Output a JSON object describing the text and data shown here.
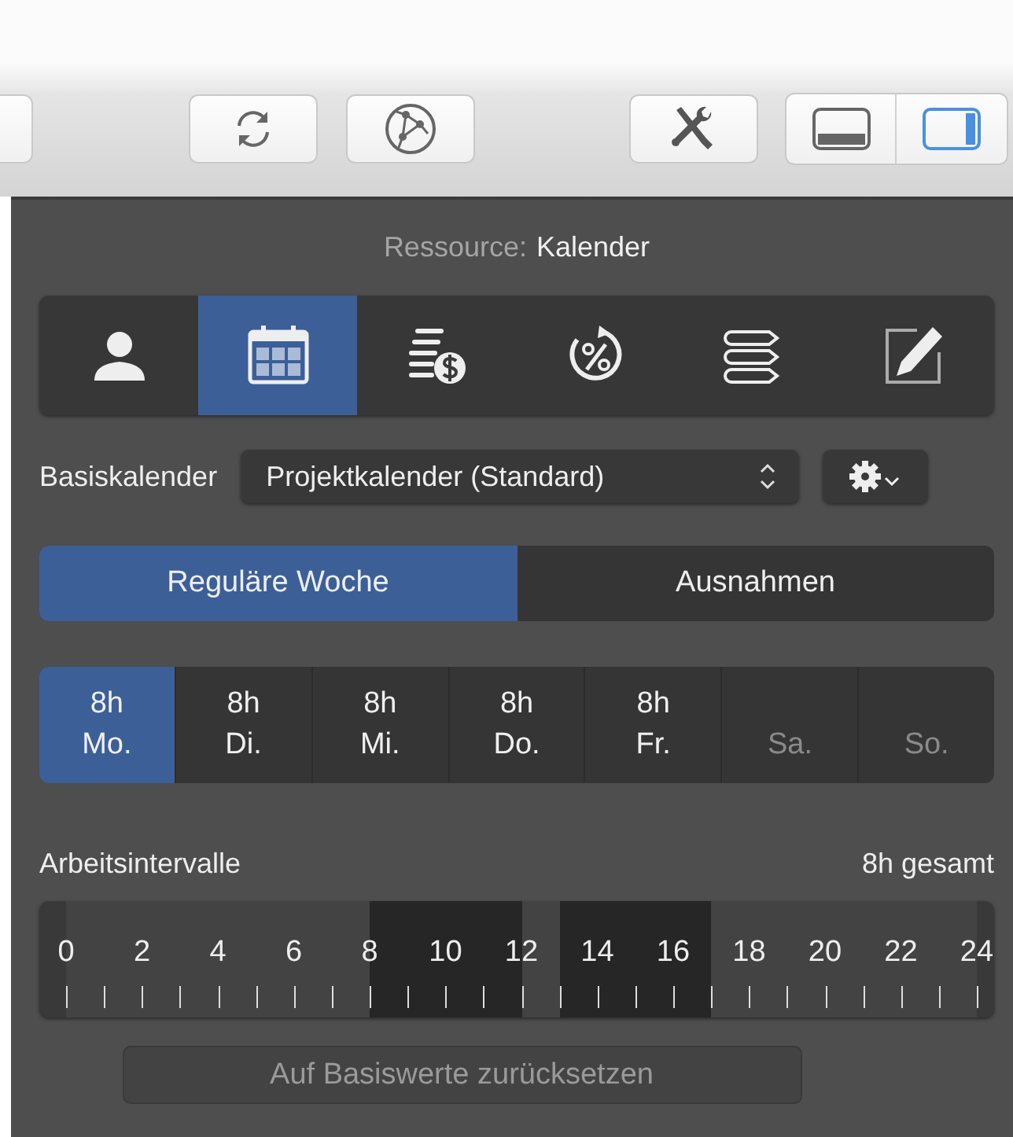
{
  "toolbar": {
    "buttons": [
      {
        "kind": "partial"
      },
      {
        "kind": "refresh"
      },
      {
        "kind": "network"
      },
      {
        "kind": "tools"
      }
    ],
    "layout_toggle": [
      {
        "kind": "bottom",
        "selected": false
      },
      {
        "kind": "right",
        "selected": true
      }
    ]
  },
  "inspector": {
    "title_label": "Ressource:",
    "title_value": "Kalender",
    "tabs": [
      {
        "kind": "person",
        "selected": false
      },
      {
        "kind": "calendar",
        "selected": true
      },
      {
        "kind": "cost",
        "selected": false
      },
      {
        "kind": "percent",
        "selected": false
      },
      {
        "kind": "list",
        "selected": false
      },
      {
        "kind": "edit",
        "selected": false
      }
    ],
    "base_calendar": {
      "label": "Basiskalender",
      "value": "Projektkalender (Standard)"
    },
    "mode": [
      {
        "label": "Reguläre Woche",
        "selected": true
      },
      {
        "label": "Ausnahmen",
        "selected": false
      }
    ],
    "days": [
      {
        "hours": "8h",
        "label": "Mo.",
        "selected": true,
        "disabled": false
      },
      {
        "hours": "8h",
        "label": "Di.",
        "selected": false,
        "disabled": false
      },
      {
        "hours": "8h",
        "label": "Mi.",
        "selected": false,
        "disabled": false
      },
      {
        "hours": "8h",
        "label": "Do.",
        "selected": false,
        "disabled": false
      },
      {
        "hours": "8h",
        "label": "Fr.",
        "selected": false,
        "disabled": false
      },
      {
        "label": "Sa.",
        "selected": false,
        "disabled": true
      },
      {
        "label": "So.",
        "selected": false,
        "disabled": true
      }
    ],
    "intervals": {
      "label": "Arbeitsintervalle",
      "total": "8h gesamt",
      "hour_labels": [
        "0",
        "2",
        "4",
        "6",
        "8",
        "10",
        "12",
        "14",
        "16",
        "18",
        "20",
        "22",
        "24"
      ],
      "working_hours": [
        false,
        false,
        false,
        false,
        false,
        false,
        false,
        false,
        true,
        true,
        true,
        true,
        false,
        true,
        true,
        true,
        true,
        false,
        false,
        false,
        false,
        false,
        false,
        false
      ]
    },
    "reset_button": {
      "label": "Auf Basiswerte zurücksetzen",
      "disabled": true
    }
  }
}
